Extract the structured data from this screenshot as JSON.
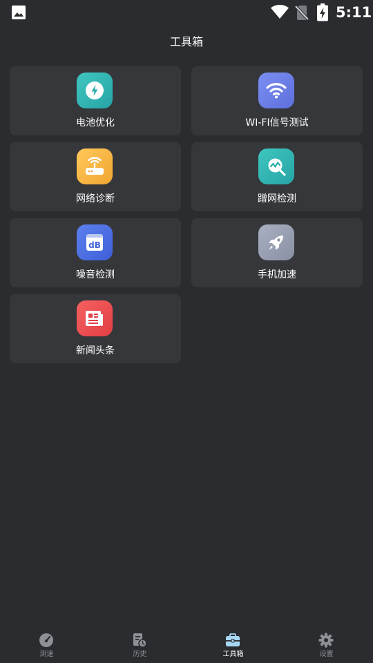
{
  "status_bar": {
    "time": "5:11",
    "icons": [
      "gallery-icon",
      "wifi-icon",
      "no-sim-icon",
      "battery-charging-icon"
    ]
  },
  "header": {
    "title": "工具箱"
  },
  "tools": [
    {
      "label": "电池优化",
      "icon": "bolt-icon",
      "color": "#2fb5b0"
    },
    {
      "label": "WI-FI信号测试",
      "icon": "wifi-signal-icon",
      "color": "#6a7ee8"
    },
    {
      "label": "网络诊断",
      "icon": "router-icon",
      "color": "#f5b544"
    },
    {
      "label": "蹭网检测",
      "icon": "network-scan-icon",
      "color": "#2fb5b0"
    },
    {
      "label": "噪音检测",
      "icon": "decibel-icon",
      "color": "#4a6ee0"
    },
    {
      "label": "手机加速",
      "icon": "rocket-icon",
      "color": "#9ba2b4"
    },
    {
      "label": "新闻头条",
      "icon": "newspaper-icon",
      "color": "#ee4f52"
    }
  ],
  "bottom_nav": {
    "active": "工具箱",
    "items": [
      {
        "label": "测速",
        "icon": "speedometer-icon"
      },
      {
        "label": "历史",
        "icon": "history-icon"
      },
      {
        "label": "工具箱",
        "icon": "toolbox-icon"
      },
      {
        "label": "设置",
        "icon": "gear-icon"
      }
    ]
  },
  "colors": {
    "background": "#2b2c30",
    "card": "#36373b",
    "nav_inactive": "#8e9096",
    "nav_active": "#ffffff",
    "active_icon": "#a9d8f5"
  }
}
